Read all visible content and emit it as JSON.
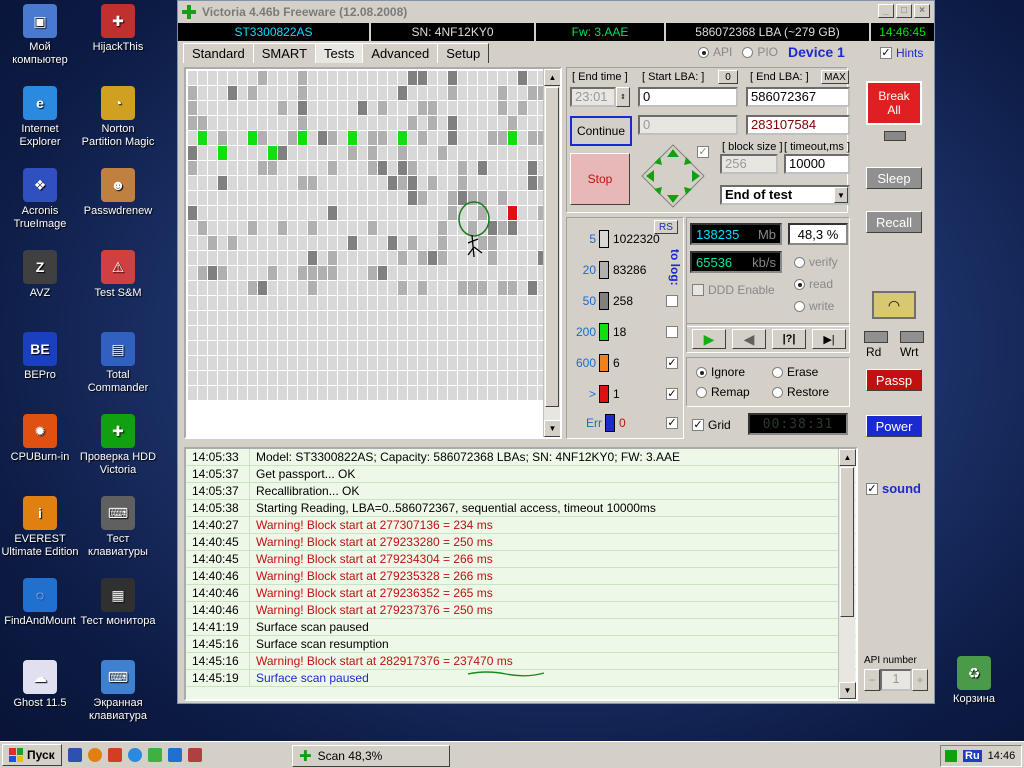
{
  "desktop": {
    "icons": [
      {
        "label": "Мой\nкомпьютер",
        "color": "#4a7ad0",
        "glyph": "▣"
      },
      {
        "label": "HijackThis",
        "color": "#c03030",
        "glyph": "✚"
      },
      {
        "label": "Internet\nExplorer",
        "color": "#2a8ae0",
        "glyph": "e"
      },
      {
        "label": "Norton\nPartition Magic",
        "color": "#d0a020",
        "glyph": "◔"
      },
      {
        "label": "Acronis\nTrueImage",
        "color": "#3050c0",
        "glyph": "❖"
      },
      {
        "label": "Passwdrenew",
        "color": "#c08040",
        "glyph": "☻"
      },
      {
        "label": "AVZ",
        "color": "#404040",
        "glyph": "Z"
      },
      {
        "label": "Test S&M",
        "color": "#d04040",
        "glyph": "⚠"
      },
      {
        "label": "BEPro",
        "color": "#1a40c0",
        "glyph": "BE"
      },
      {
        "label": "Total\nCommander",
        "color": "#3060c0",
        "glyph": "▤"
      },
      {
        "label": "CPUBurn-in",
        "color": "#e05010",
        "glyph": "✹"
      },
      {
        "label": "Проверка HDD\nVictoria",
        "color": "#10a010",
        "glyph": "✚"
      },
      {
        "label": "EVEREST\nUltimate Edition",
        "color": "#e08010",
        "glyph": "i"
      },
      {
        "label": "Тест\nклавиатуры",
        "color": "#606060",
        "glyph": "⌨"
      },
      {
        "label": "FindAndMount",
        "color": "#2070d0",
        "glyph": "◌"
      },
      {
        "label": "Тест монитора",
        "color": "#303030",
        "glyph": "▦"
      },
      {
        "label": "Ghost 11.5",
        "color": "#e0e0f0",
        "glyph": "☁"
      },
      {
        "label": "Экранная\nклавиатура",
        "color": "#4080d0",
        "glyph": "⌨"
      }
    ],
    "recycle_label": "Корзина"
  },
  "window": {
    "title": "Victoria 4.46b Freeware (12.08.2008)",
    "minimize": "_",
    "maximize": "□",
    "close": "×"
  },
  "info": {
    "model": "ST3300822AS",
    "sn": "SN: 4NF12KY0",
    "fw": "Fw: 3.AAE",
    "lba": "586072368 LBA (~279 GB)",
    "time": "14:46:45"
  },
  "tabs": [
    "Standard",
    "SMART",
    "Tests",
    "Advanced",
    "Setup"
  ],
  "api": {
    "api_label": "API",
    "pio_label": "PIO",
    "device": "Device 1",
    "hints": "Hints"
  },
  "tests": {
    "end_time_label": "[ End time ]",
    "end_time_value": "23:01",
    "start_lba_label": "[ Start LBA: ]",
    "start_lba_btn": "0",
    "start_lba_value": "0",
    "end_lba_label": "[ End LBA: ]",
    "end_lba_btn": "MAX",
    "end_lba_value": "586072367",
    "current_value": "0",
    "current_lba": "283107584",
    "continue_label": "Continue",
    "stop_label": "Stop",
    "block_size_label": "[ block size ]",
    "block_size_value": "256",
    "timeout_label": "[ timeout,ms ]",
    "timeout_value": "10000",
    "end_action": "End of test",
    "rs_label": "RS",
    "to_log_label": "to log:",
    "legend": [
      {
        "num": "5",
        "color": "#d8d8d8",
        "count": "1022320",
        "log": null
      },
      {
        "num": "20",
        "color": "#b0b0b0",
        "count": "83286",
        "log": null
      },
      {
        "num": "50",
        "color": "#808080",
        "count": "258",
        "log": false
      },
      {
        "num": "200",
        "color": "#10e010",
        "count": "18",
        "log": false
      },
      {
        "num": "600",
        "color": "#f08020",
        "count": "6",
        "log": true
      },
      {
        "num": ">",
        "color": "#e01010",
        "count": "1",
        "log": true
      },
      {
        "num": "Err",
        "color": "#1a2ad0",
        "count": "0",
        "log": true
      }
    ],
    "mb_value": "138235",
    "mb_unit": "Mb",
    "percent": "48,3",
    "percent_unit": "%",
    "speed_value": "65536",
    "speed_unit": "kb/s",
    "verify": "verify",
    "read": "read",
    "write": "write",
    "ddd": "DDD Enable",
    "ignore": "Ignore",
    "erase": "Erase",
    "remap": "Remap",
    "restore": "Restore",
    "grid": "Grid",
    "timer": "00:38:31",
    "play_glyph": "▶",
    "back_glyph": "◀",
    "qmark": "|?|",
    "end_glyph": "▶|"
  },
  "right": {
    "break_all": "Break\nAll",
    "sleep": "Sleep",
    "recall": "Recall",
    "rd": "Rd",
    "wrt": "Wrt",
    "passp": "Passp",
    "power": "Power",
    "sound": "sound",
    "api_number_label": "API number",
    "api_number": "1",
    "minus": "−",
    "plus": "+"
  },
  "log": [
    {
      "time": "14:05:33",
      "msg": "Model: ST3300822AS; Capacity: 586072368 LBAs; SN: 4NF12KY0; FW: 3.AAE",
      "type": "info"
    },
    {
      "time": "14:05:37",
      "msg": "Get passport... OK",
      "type": "info"
    },
    {
      "time": "14:05:37",
      "msg": "Recallibration... OK",
      "type": "info"
    },
    {
      "time": "14:05:38",
      "msg": "Starting Reading, LBA=0..586072367, sequential access, timeout 10000ms",
      "type": "info"
    },
    {
      "time": "14:40:27",
      "msg": "Warning! Block start at 277307136 = 234 ms",
      "type": "warn"
    },
    {
      "time": "14:40:45",
      "msg": "Warning! Block start at 279233280 = 250 ms",
      "type": "warn"
    },
    {
      "time": "14:40:45",
      "msg": "Warning! Block start at 279234304 = 266 ms",
      "type": "warn"
    },
    {
      "time": "14:40:46",
      "msg": "Warning! Block start at 279235328 = 266 ms",
      "type": "warn"
    },
    {
      "time": "14:40:46",
      "msg": "Warning! Block start at 279236352 = 265 ms",
      "type": "warn"
    },
    {
      "time": "14:40:46",
      "msg": "Warning! Block start at 279237376 = 250 ms",
      "type": "warn"
    },
    {
      "time": "14:41:19",
      "msg": "Surface scan paused",
      "type": "info"
    },
    {
      "time": "14:45:16",
      "msg": "Surface scan resumption",
      "type": "info"
    },
    {
      "time": "14:45:16",
      "msg": "Warning! Block start at 282917376 = 237470 ms",
      "type": "warn"
    },
    {
      "time": "14:45:19",
      "msg": "Surface scan paused",
      "type": "blue"
    }
  ],
  "taskbar": {
    "start": "Пуск",
    "task": "Scan 48,3%",
    "lang": "Ru",
    "clock": "14:46"
  },
  "colors": {
    "warn": "#c01010",
    "blue": "#1a2ad0",
    "info": "#000000"
  }
}
